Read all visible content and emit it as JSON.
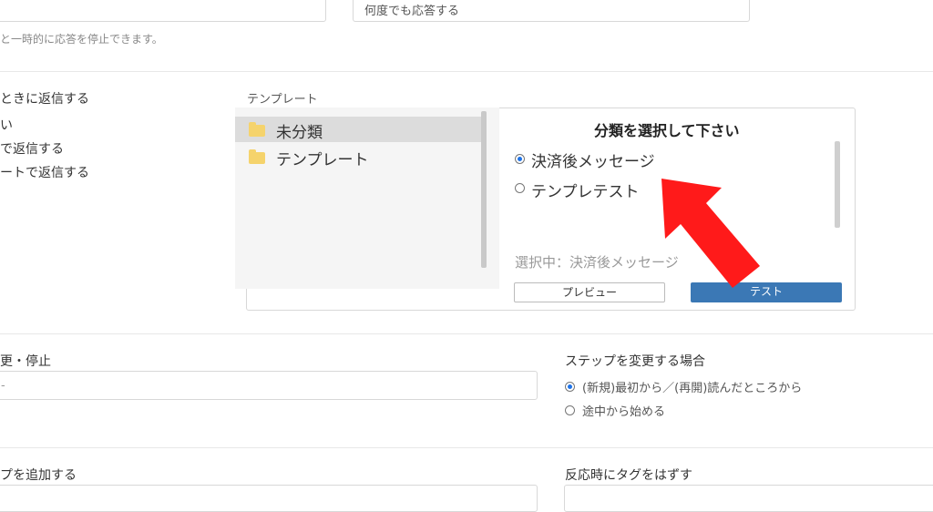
{
  "top": {
    "response_mode_value": "何度でも応答する",
    "pause_hint": "と一時的に応答を停止できます。"
  },
  "reply": {
    "heading": "ときに返信する",
    "options": [
      "い",
      "で返信する",
      "ートで返信する"
    ]
  },
  "template": {
    "label": "テンプレート",
    "folders": [
      "未分類",
      "テンプレート"
    ],
    "panel_title": "分類を選択して下さい",
    "choices": [
      "決済後メッセージ",
      "テンプレテスト"
    ],
    "selected_text": "選択中：決済後メッセージ",
    "preview_label": "プレビュー",
    "test_label": "テスト"
  },
  "step": {
    "left_label": "更・停止",
    "left_value": "-",
    "right_label": "ステップを変更する場合",
    "options": [
      "(新規)最初から／(再開)読んだところから",
      "途中から始める"
    ]
  },
  "tags": {
    "add_label": "プを追加する",
    "remove_label": "反応時にタグをはずす"
  },
  "colors": {
    "accent": "#3b78b5",
    "arrow": "#ff1a1a",
    "radio_selected": "#1e73e8"
  }
}
